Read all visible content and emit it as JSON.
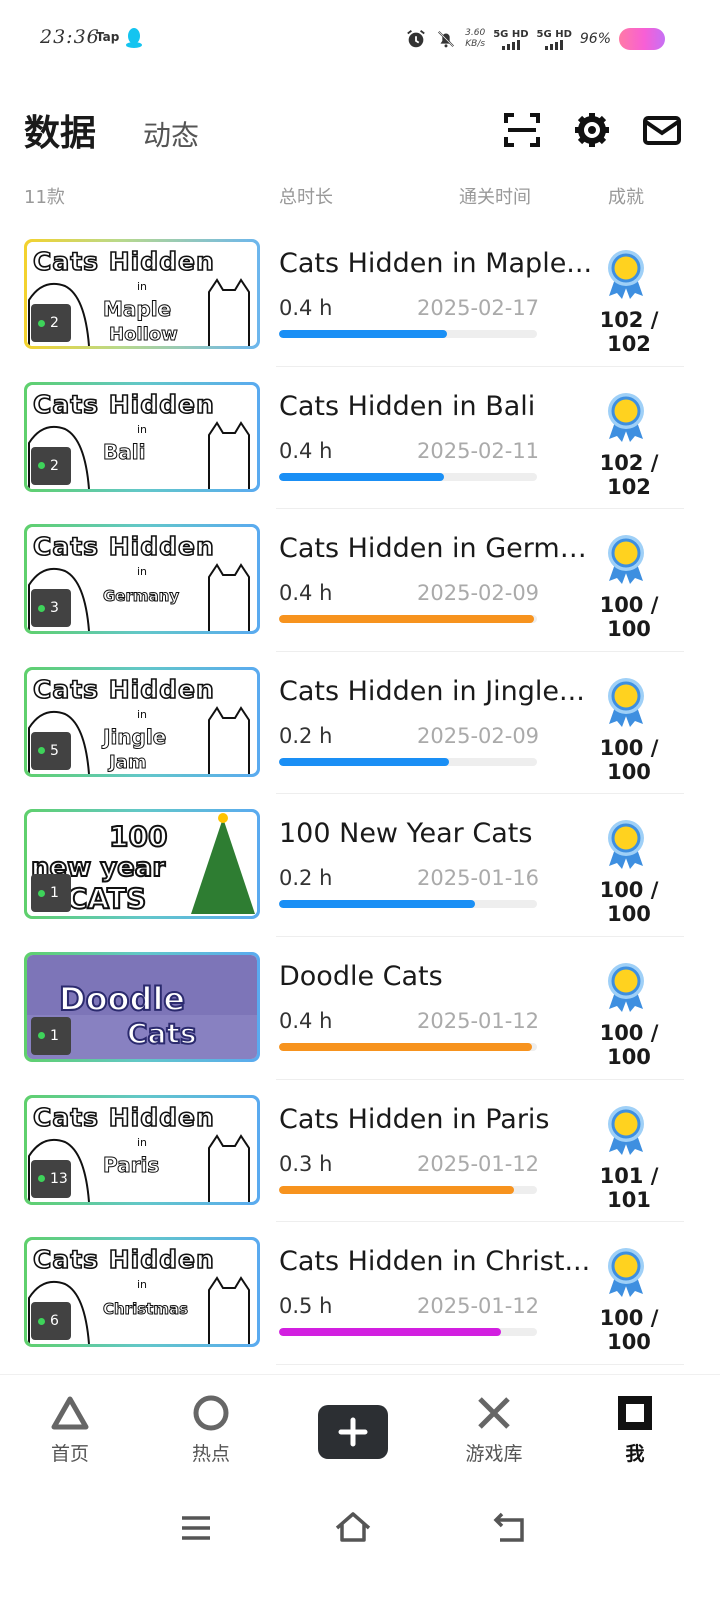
{
  "status_bar": {
    "time": "23:36",
    "app_label": "Tap",
    "net_speed_value": "3.60",
    "net_speed_unit": "KB/s",
    "sim1": "5G HD",
    "sim2": "5G HD",
    "battery": "96%"
  },
  "header": {
    "active_tab": "数据",
    "inactive_tab": "动态",
    "icons": [
      "scan-icon",
      "settings-icon",
      "mail-icon"
    ]
  },
  "columns": {
    "count": "11款",
    "total_time": "总时长",
    "clear_time": "通关时间",
    "achievements": "成就"
  },
  "games": [
    {
      "name": "Cats Hidden in Maple...",
      "count": "2",
      "hours": "0.4 h",
      "date": "2025-02-17",
      "progress": 0.65,
      "bar_color": "#1a8ff5",
      "achievements": "102 / 102",
      "frame": "linear-gradient(90deg,#f4d22d,#b9d98a 40%,#6cb6ee)",
      "cover_line1": "Cats Hidden",
      "cover_line2": "in",
      "cover_line3": "Maple",
      "cover_line4": "Hollow"
    },
    {
      "name": "Cats Hidden in Bali",
      "count": "2",
      "hours": "0.4 h",
      "date": "2025-02-11",
      "progress": 0.64,
      "bar_color": "#1a8ff5",
      "achievements": "102 / 102",
      "frame": "linear-gradient(90deg,#5fd06c,#62c7c9 50%,#5aaaf0)",
      "cover_line1": "Cats Hidden",
      "cover_line2": "in",
      "cover_line3": "Bali",
      "cover_line4": ""
    },
    {
      "name": "Cats Hidden in Germa...",
      "count": "3",
      "hours": "0.4 h",
      "date": "2025-02-09",
      "progress": 0.99,
      "bar_color": "#f7931e",
      "achievements": "100 / 100",
      "frame": "linear-gradient(90deg,#5fd06c,#62c7c9 50%,#5aaaf0)",
      "cover_line1": "Cats Hidden",
      "cover_line2": "in",
      "cover_line3": "Germany",
      "cover_line4": ""
    },
    {
      "name": "Cats Hidden in Jingle...",
      "count": "5",
      "hours": "0.2 h",
      "date": "2025-02-09",
      "progress": 0.66,
      "bar_color": "#1a8ff5",
      "achievements": "100 / 100",
      "frame": "linear-gradient(90deg,#5fd06c,#62c7c9 50%,#5aaaf0)",
      "cover_line1": "Cats Hidden",
      "cover_line2": "in",
      "cover_line3": "Jingle",
      "cover_line4": "Jam"
    },
    {
      "name": "100 New Year Cats",
      "count": "1",
      "hours": "0.2 h",
      "date": "2025-01-16",
      "progress": 0.76,
      "bar_color": "#1a8ff5",
      "achievements": "100 / 100",
      "frame": "linear-gradient(90deg,#5fd06c,#62c7c9 50%,#5aaaf0)",
      "cover_line1": "100",
      "cover_line2": "new year",
      "cover_line3": "CATS",
      "cover_line4": ""
    },
    {
      "name": "Doodle Cats",
      "count": "1",
      "hours": "0.4 h",
      "date": "2025-01-12",
      "progress": 0.98,
      "bar_color": "#f7931e",
      "achievements": "100 / 100",
      "frame": "linear-gradient(90deg,#5fd06c,#62c7c9 50%,#5aaaf0)",
      "cover_line1": "Doodle",
      "cover_line2": "Cats",
      "cover_line3": "",
      "cover_line4": ""
    },
    {
      "name": "Cats Hidden in Paris",
      "count": "13",
      "hours": "0.3 h",
      "date": "2025-01-12",
      "progress": 0.91,
      "bar_color": "#f7931e",
      "achievements": "101 / 101",
      "frame": "linear-gradient(90deg,#5fd06c,#62c7c9 50%,#5aaaf0)",
      "cover_line1": "Cats Hidden",
      "cover_line2": "in",
      "cover_line3": "Paris",
      "cover_line4": ""
    },
    {
      "name": "Cats Hidden in Christ...",
      "count": "6",
      "hours": "0.5 h",
      "date": "2025-01-12",
      "progress": 0.86,
      "bar_color": "#d21fe0",
      "achievements": "100 / 100",
      "frame": "linear-gradient(90deg,#5fd06c,#62c7c9 50%,#5aaaf0)",
      "cover_line1": "Cats Hidden",
      "cover_line2": "in",
      "cover_line3": "Christmas",
      "cover_line4": ""
    }
  ],
  "colors": {
    "award_gold": "#ffd21f",
    "award_ribbon": "#3e8fe0"
  },
  "bottom_nav": [
    {
      "label": "首页",
      "icon": "triangle-icon",
      "active": false
    },
    {
      "label": "热点",
      "icon": "circle-icon",
      "active": false
    },
    {
      "label": "",
      "icon": "plus-icon",
      "active": false
    },
    {
      "label": "游戏库",
      "icon": "cross-icon",
      "active": false
    },
    {
      "label": "我",
      "icon": "square-icon",
      "active": true
    }
  ],
  "system_nav": [
    "menu-icon",
    "home-icon",
    "back-icon"
  ]
}
